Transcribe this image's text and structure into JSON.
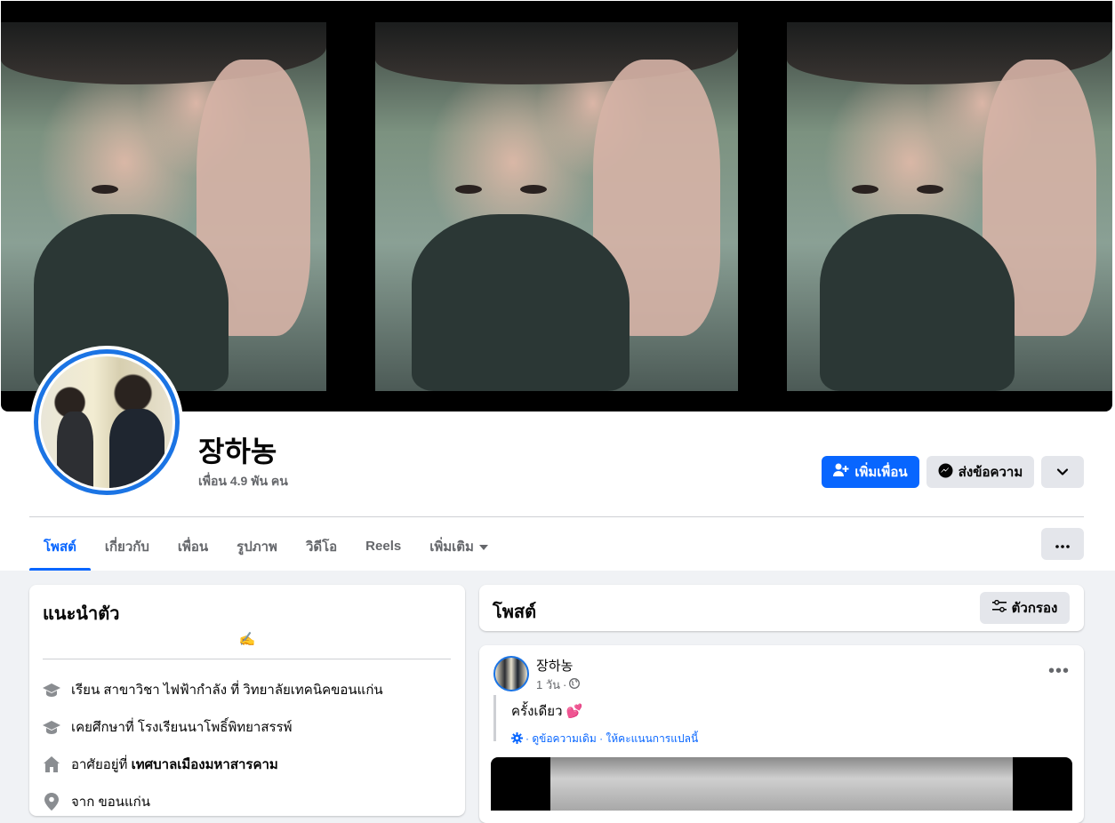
{
  "profile": {
    "name": "장하농",
    "friends_count": "เพื่อน 4.9 พัน คน"
  },
  "actions": {
    "add_friend": "เพิ่มเพื่อน",
    "message": "ส่งข้อความ"
  },
  "tabs": [
    {
      "label": "โพสต์",
      "active": true
    },
    {
      "label": "เกี่ยวกับ"
    },
    {
      "label": "เพื่อน"
    },
    {
      "label": "รูปภาพ"
    },
    {
      "label": "วิดีโอ"
    },
    {
      "label": "Reels"
    },
    {
      "label": "เพิ่มเติม"
    }
  ],
  "intro": {
    "title": "แนะนำตัว",
    "bio_emoji": "✍️",
    "items": [
      {
        "icon": "graduation-cap-icon",
        "text": "เรียน สาขาวิชา ไฟฟ้ากำลัง ที่ วิทยาลัยเทคนิคขอนแก่น"
      },
      {
        "icon": "graduation-cap-icon",
        "text": "เคยศึกษาที่ โรงเรียนนาโพธิ์พิทยาสรรพ์"
      },
      {
        "icon": "home-icon",
        "text_prefix": "อาศัยอยู่ที่ ",
        "text_bold": "เทศบาลเมืองมหาสารคาม"
      },
      {
        "icon": "location-pin-icon",
        "text": "จาก ขอนแก่น"
      }
    ]
  },
  "posts_header": {
    "title": "โพสต์",
    "filter_label": "ตัวกรอง"
  },
  "post": {
    "author": "장하농",
    "time": "1 วัน",
    "text": "ครั้งเดียว",
    "text_emoji": "💕",
    "translate_links": "· ดูข้อความเดิม · ให้คะแนนการแปลนี้"
  },
  "colors": {
    "accent": "#0866ff",
    "page_bg": "#f0f2f5",
    "muted_text": "#65676b"
  }
}
